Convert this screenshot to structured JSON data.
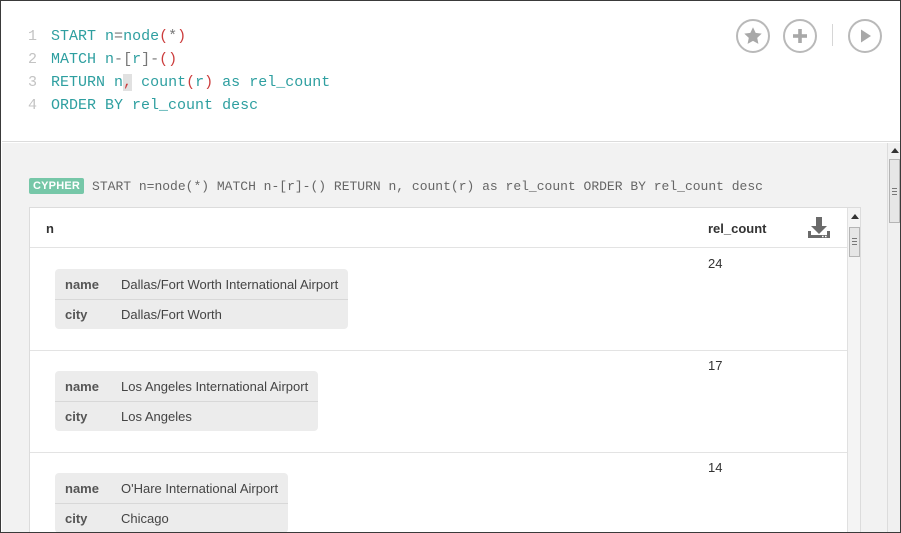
{
  "editor": {
    "lines": [
      {
        "num": "1",
        "tokens": [
          {
            "t": "START",
            "c": "kw"
          },
          {
            "t": " ",
            "c": "op"
          },
          {
            "t": "n",
            "c": "id"
          },
          {
            "t": "=",
            "c": "op"
          },
          {
            "t": "node",
            "c": "fn"
          },
          {
            "t": "(",
            "c": "par"
          },
          {
            "t": "*",
            "c": "op"
          },
          {
            "t": ")",
            "c": "par"
          }
        ]
      },
      {
        "num": "2",
        "tokens": [
          {
            "t": "MATCH",
            "c": "kw"
          },
          {
            "t": " ",
            "c": "op"
          },
          {
            "t": "n",
            "c": "id"
          },
          {
            "t": "-",
            "c": "op"
          },
          {
            "t": "[",
            "c": "op"
          },
          {
            "t": "r",
            "c": "id"
          },
          {
            "t": "]",
            "c": "op"
          },
          {
            "t": "-",
            "c": "op"
          },
          {
            "t": "()",
            "c": "par"
          }
        ]
      },
      {
        "num": "3",
        "tokens": [
          {
            "t": "RETURN",
            "c": "kw"
          },
          {
            "t": " ",
            "c": "op"
          },
          {
            "t": "n",
            "c": "id"
          },
          {
            "t": ",",
            "c": "cursor-hl"
          },
          {
            "t": " ",
            "c": "op"
          },
          {
            "t": "count",
            "c": "fn"
          },
          {
            "t": "(",
            "c": "par"
          },
          {
            "t": "r",
            "c": "id"
          },
          {
            "t": ")",
            "c": "par"
          },
          {
            "t": " ",
            "c": "op"
          },
          {
            "t": "as",
            "c": "kw"
          },
          {
            "t": " ",
            "c": "op"
          },
          {
            "t": "rel_count",
            "c": "id"
          }
        ]
      },
      {
        "num": "4",
        "tokens": [
          {
            "t": "ORDER BY",
            "c": "kw"
          },
          {
            "t": " ",
            "c": "op"
          },
          {
            "t": "rel_count",
            "c": "id"
          },
          {
            "t": " ",
            "c": "op"
          },
          {
            "t": "desc",
            "c": "kw"
          }
        ]
      }
    ],
    "buttons": [
      "star-icon",
      "plus-icon",
      "play-icon"
    ]
  },
  "result": {
    "badge": "CYPHER",
    "query": "START n=node(*) MATCH n-[r]-() RETURN n, count(r) as rel_count ORDER BY rel_count desc",
    "columns": {
      "n": "n",
      "rel_count": "rel_count"
    },
    "download_icon": "download-icon",
    "rows": [
      {
        "rel_count": "24",
        "props": [
          {
            "key": "name",
            "value": "Dallas/Fort Worth International Airport"
          },
          {
            "key": "city",
            "value": "Dallas/Fort Worth"
          }
        ]
      },
      {
        "rel_count": "17",
        "props": [
          {
            "key": "name",
            "value": "Los Angeles International Airport"
          },
          {
            "key": "city",
            "value": "Los Angeles"
          }
        ]
      },
      {
        "rel_count": "14",
        "props": [
          {
            "key": "name",
            "value": "O'Hare International Airport"
          },
          {
            "key": "city",
            "value": "Chicago"
          }
        ]
      }
    ]
  },
  "colors": {
    "keyword": "#2e9fa0",
    "paren": "#cc3d3d",
    "badge": "#76c7a8",
    "line_number": "#c3c3c3"
  }
}
